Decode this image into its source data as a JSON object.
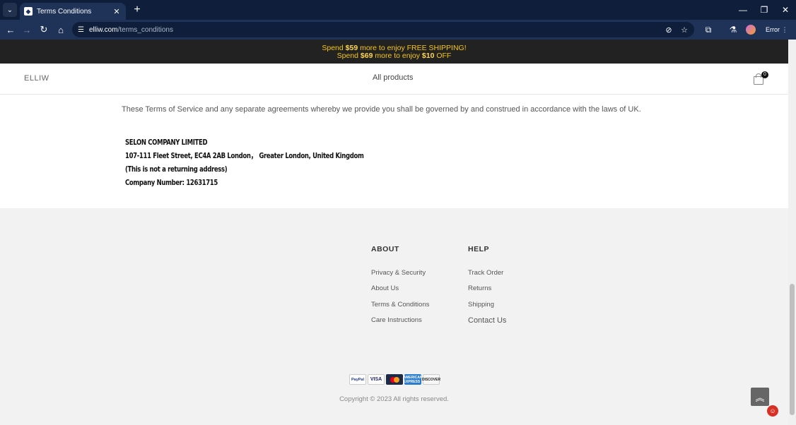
{
  "browser": {
    "tab_title": "Terms Conditions",
    "url_host": "elliw.com",
    "url_path": "/terms_conditions",
    "error_label": "Error"
  },
  "promo": {
    "line1_prefix": "Spend ",
    "line1_amount": "$59",
    "line1_suffix": " more to enjoy FREE SHIPPING!",
    "line2_prefix": "Spend ",
    "line2_amount": "$69",
    "line2_mid": " more to enjoy ",
    "line2_discount": "$10",
    "line2_suffix": " OFF"
  },
  "header": {
    "brand": "ELLIW",
    "nav_label": "All products",
    "cart_count": "0"
  },
  "content": {
    "terms_text": "These Terms of Service and any separate agreements whereby we provide you shall be governed by and construed in accordance with the laws of UK.",
    "company_lines": [
      "SELON COMPANY LIMITED",
      "107-111 Fleet Street, EC4A 2AB London，  Greater London, United Kingdom",
      "(This is not a returning address)",
      "Company Number: 12631715"
    ]
  },
  "footer": {
    "about": {
      "heading": "ABOUT",
      "links": [
        "Privacy & Security",
        "About Us",
        "Terms & Conditions",
        "Care Instructions"
      ]
    },
    "help": {
      "heading": "HELP",
      "links": [
        "Track Order",
        "Returns",
        "Shipping",
        "Contact Us"
      ]
    },
    "payments": {
      "paypal": "PayPal",
      "visa": "VISA",
      "amex": "AMERICAN EXPRESS",
      "discover": "DISCOVER"
    },
    "copyright": "Copyright © 2023 All rights reserved."
  },
  "colors": {
    "chrome_dark": "#0f1f3b",
    "chrome_toolbar": "#1f3358",
    "promo_bg": "#222222",
    "promo_text": "#f5c518"
  }
}
